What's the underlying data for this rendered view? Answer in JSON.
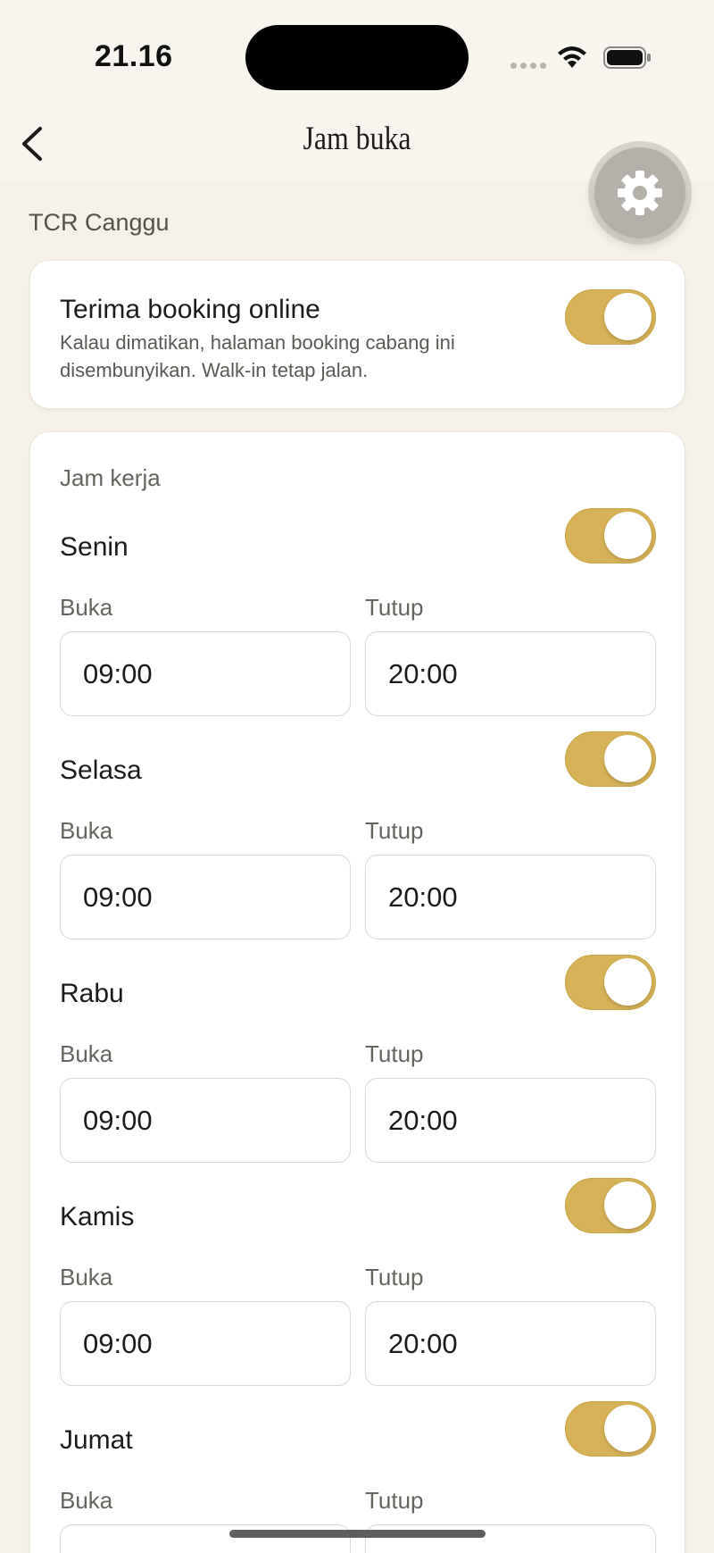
{
  "status_bar": {
    "time": "21.16"
  },
  "header": {
    "title": "Jam buka",
    "back_icon": "chevron-left-icon",
    "settings_icon": "gear-icon"
  },
  "branch": {
    "name": "TCR Canggu"
  },
  "online_booking": {
    "title": "Terima booking online",
    "description": "Kalau dimatikan, halaman booking cabang ini disembunyikan. Walk-in tetap jalan.",
    "enabled": true
  },
  "hours": {
    "section_label": "Jam kerja",
    "open_label": "Buka",
    "close_label": "Tutup",
    "days": [
      {
        "name": "Senin",
        "enabled": true,
        "open": "09:00",
        "close": "20:00"
      },
      {
        "name": "Selasa",
        "enabled": true,
        "open": "09:00",
        "close": "20:00"
      },
      {
        "name": "Rabu",
        "enabled": true,
        "open": "09:00",
        "close": "20:00"
      },
      {
        "name": "Kamis",
        "enabled": true,
        "open": "09:00",
        "close": "20:00"
      },
      {
        "name": "Jumat",
        "enabled": true,
        "open": "",
        "close": ""
      }
    ]
  },
  "colors": {
    "background": "#f5f0e8",
    "accent": "#d8b258",
    "card": "#ffffff"
  }
}
